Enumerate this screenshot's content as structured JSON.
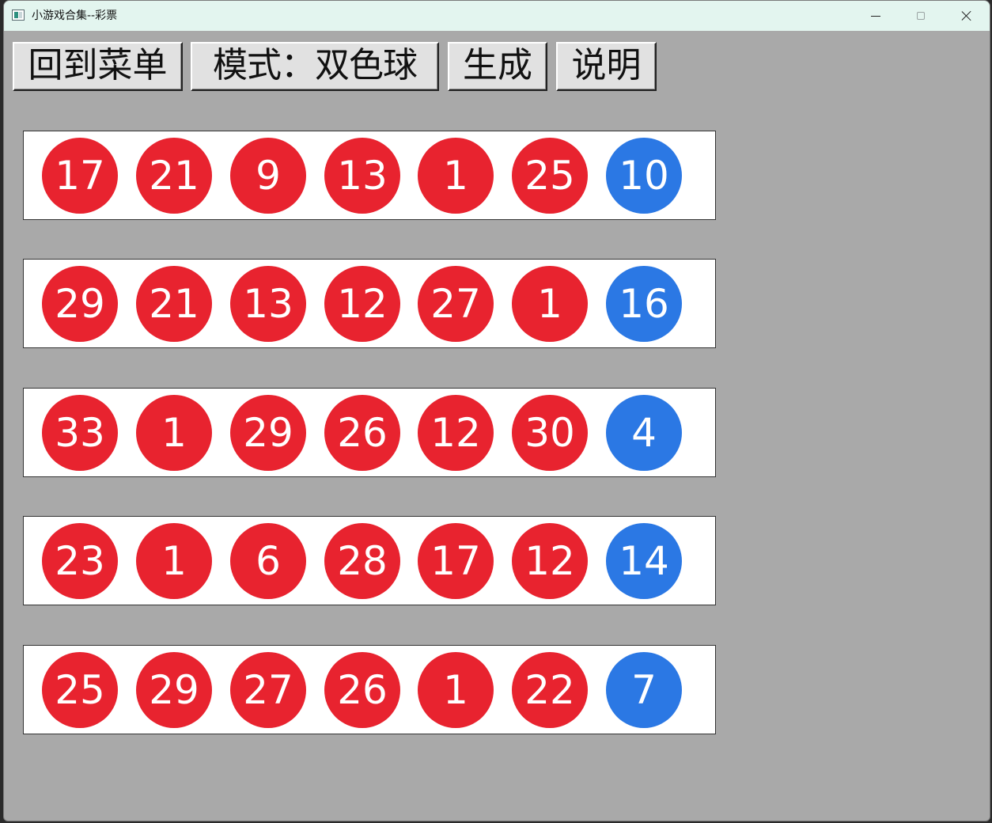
{
  "window": {
    "title": "小游戏合集--彩票"
  },
  "toolbar": {
    "menu_label": "回到菜单",
    "mode_label": "模式：双色球",
    "generate_label": "生成",
    "help_label": "说明"
  },
  "colors": {
    "red_ball": "#e8232f",
    "blue_ball": "#2b78e4",
    "background": "#a9a9a9"
  },
  "tickets": [
    {
      "red": [
        "17",
        "21",
        "9",
        "13",
        "1",
        "25"
      ],
      "blue": "10"
    },
    {
      "red": [
        "29",
        "21",
        "13",
        "12",
        "27",
        "1"
      ],
      "blue": "16"
    },
    {
      "red": [
        "33",
        "1",
        "29",
        "26",
        "12",
        "30"
      ],
      "blue": "4"
    },
    {
      "red": [
        "23",
        "1",
        "6",
        "28",
        "17",
        "12"
      ],
      "blue": "14"
    },
    {
      "red": [
        "25",
        "29",
        "27",
        "26",
        "1",
        "22"
      ],
      "blue": "7"
    }
  ]
}
